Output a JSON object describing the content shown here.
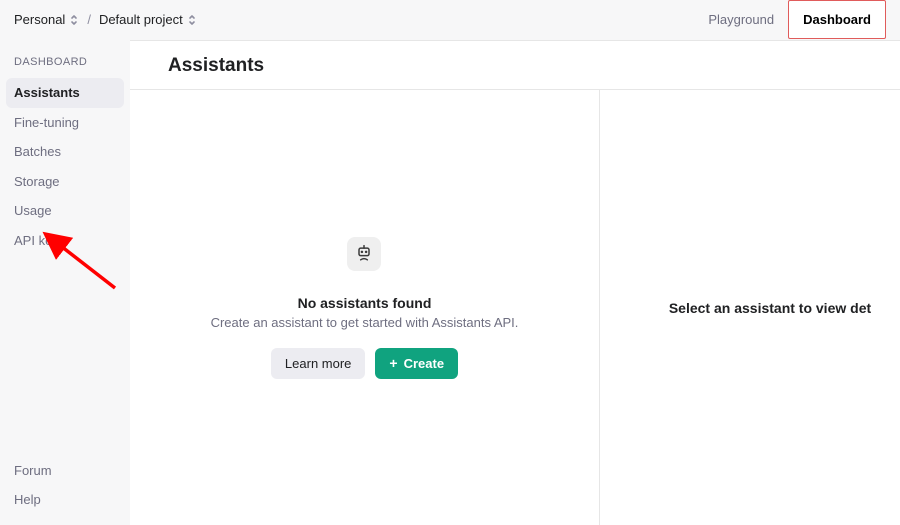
{
  "breadcrumb": {
    "org": "Personal",
    "project": "Default project",
    "sep": "/"
  },
  "topnav": {
    "playground": "Playground",
    "dashboard": "Dashboard"
  },
  "sidebar": {
    "header": "DASHBOARD",
    "items": [
      {
        "label": "Assistants"
      },
      {
        "label": "Fine-tuning"
      },
      {
        "label": "Batches"
      },
      {
        "label": "Storage"
      },
      {
        "label": "Usage"
      },
      {
        "label": "API keys"
      }
    ],
    "footer": [
      {
        "label": "Forum"
      },
      {
        "label": "Help"
      }
    ]
  },
  "page": {
    "title": "Assistants"
  },
  "empty_state": {
    "title": "No assistants found",
    "subtitle": "Create an assistant to get started with Assistants API.",
    "learn_more": "Learn more",
    "create": "Create"
  },
  "detail_placeholder": "Select an assistant to view det",
  "annotation": {
    "arrow_target": "API keys"
  }
}
